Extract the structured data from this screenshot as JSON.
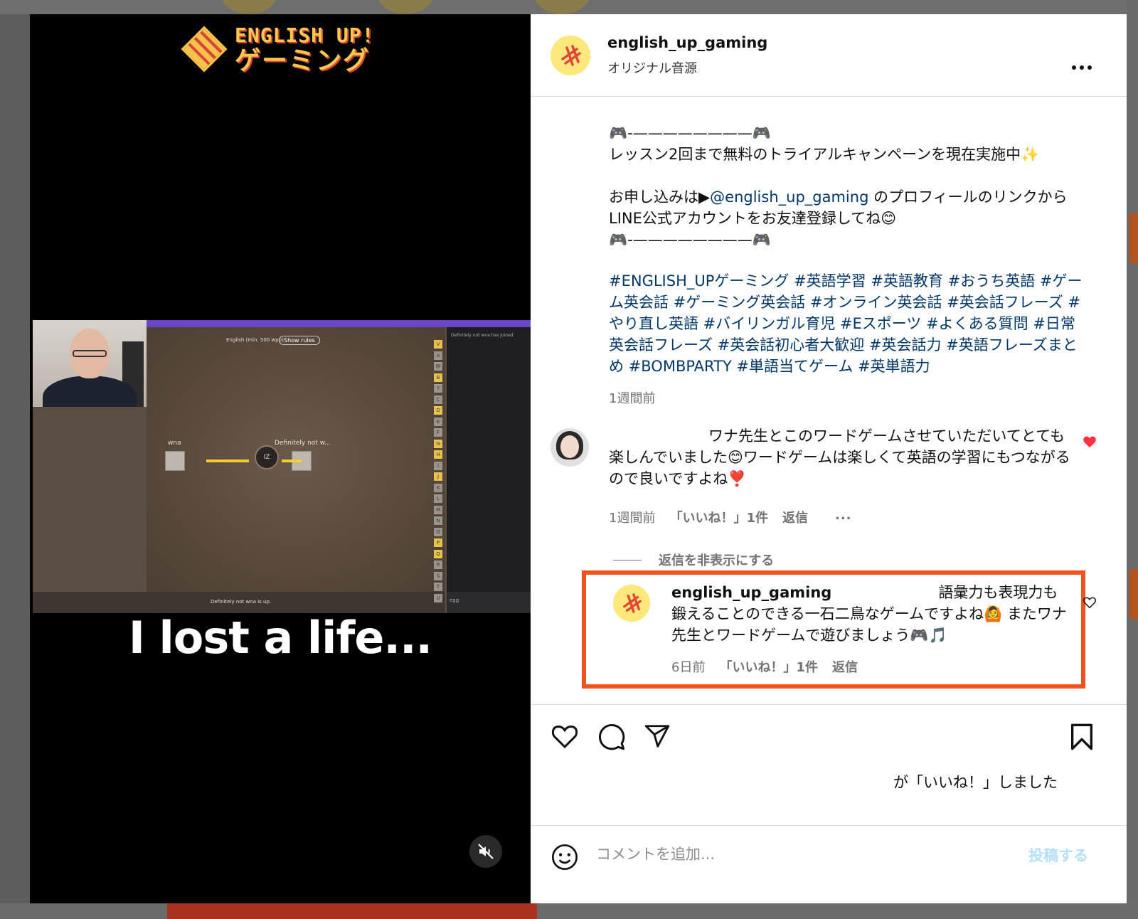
{
  "colors": {
    "highlight": "#f0531c",
    "link": "#00376b",
    "heart": "#ff3040",
    "brand_yellow": "#fbe77a"
  },
  "video": {
    "logo": {
      "line1": "ENGLISH UP!",
      "line2": "ゲーミング"
    },
    "game": {
      "mode_label": "English (min. 500 wpp)",
      "rules_button": "Show rules",
      "player1": "wna",
      "player2": "Definitely not w...",
      "bomb_syllable": "IZ",
      "status_line": "Definitely not wna is up.",
      "chat_line": "Definitely not wna has joined.",
      "chat_input": "egg",
      "letters": [
        "V",
        "A",
        "W",
        "B",
        "Y",
        "C",
        "D",
        "E",
        "F",
        "G",
        "H",
        "I",
        "J",
        "K",
        "L",
        "M",
        "N",
        "O",
        "P",
        "Q",
        "R",
        "S",
        "T",
        "U"
      ]
    },
    "caption": "I lost a life...",
    "mute_icon": "speaker-muted-icon"
  },
  "post": {
    "header": {
      "username": "english_up_gaming",
      "audio": "オリジナル音源",
      "more": "..."
    },
    "caption": {
      "divider1": "🎮-————————🎮",
      "line1": "レッスン2回まで無料のトライアルキャンペーンを現在実施中✨",
      "apply_prefix": "お申し込みは▶",
      "mention": "@english_up_gaming",
      "apply_suffix": " のプロフィールのリンクからLINE公式アカウントをお友達登録してね😊",
      "divider2": "🎮-————————🎮",
      "hashtags": "#ENGLISH_UPゲーミング #英語学習 #英語教育 #おうち英語 #ゲーム英会話 #ゲーミング英会話 #オンライン英会話 #英会話フレーズ #やり直し英語 #バイリンガル育児 #Eスポーツ #よくある質問 #日常英会話フレーズ #英会話初心者大歓迎 #英会話力 #英語フレーズまとめ #BOMBPARTY #単語当てゲーム #英単語力"
    },
    "time": "1週間前",
    "comment": {
      "text": "ワナ先生とこのワードゲームさせていただいてとても楽しんでいました😊ワードゲームは楽しくて英語の学習にもつながるので良いですよね❣️",
      "time": "1週間前",
      "likes": "「いいね！」1件",
      "reply": "返信",
      "more": "..."
    },
    "hide_replies": "返信を非表示にする",
    "reply": {
      "username": "english_up_gaming",
      "text": "語彙力も表現力も鍛えることのできる一石二鳥なゲームですよね🙆 またワナ先生とワードゲームで遊びましょう🎮🎵",
      "time": "6日前",
      "likes": "「いいね！」1件",
      "reply": "返信"
    },
    "liked_by": "が「いいね！」しました",
    "comment_box": {
      "placeholder": "コメントを追加...",
      "post": "投稿する"
    }
  }
}
